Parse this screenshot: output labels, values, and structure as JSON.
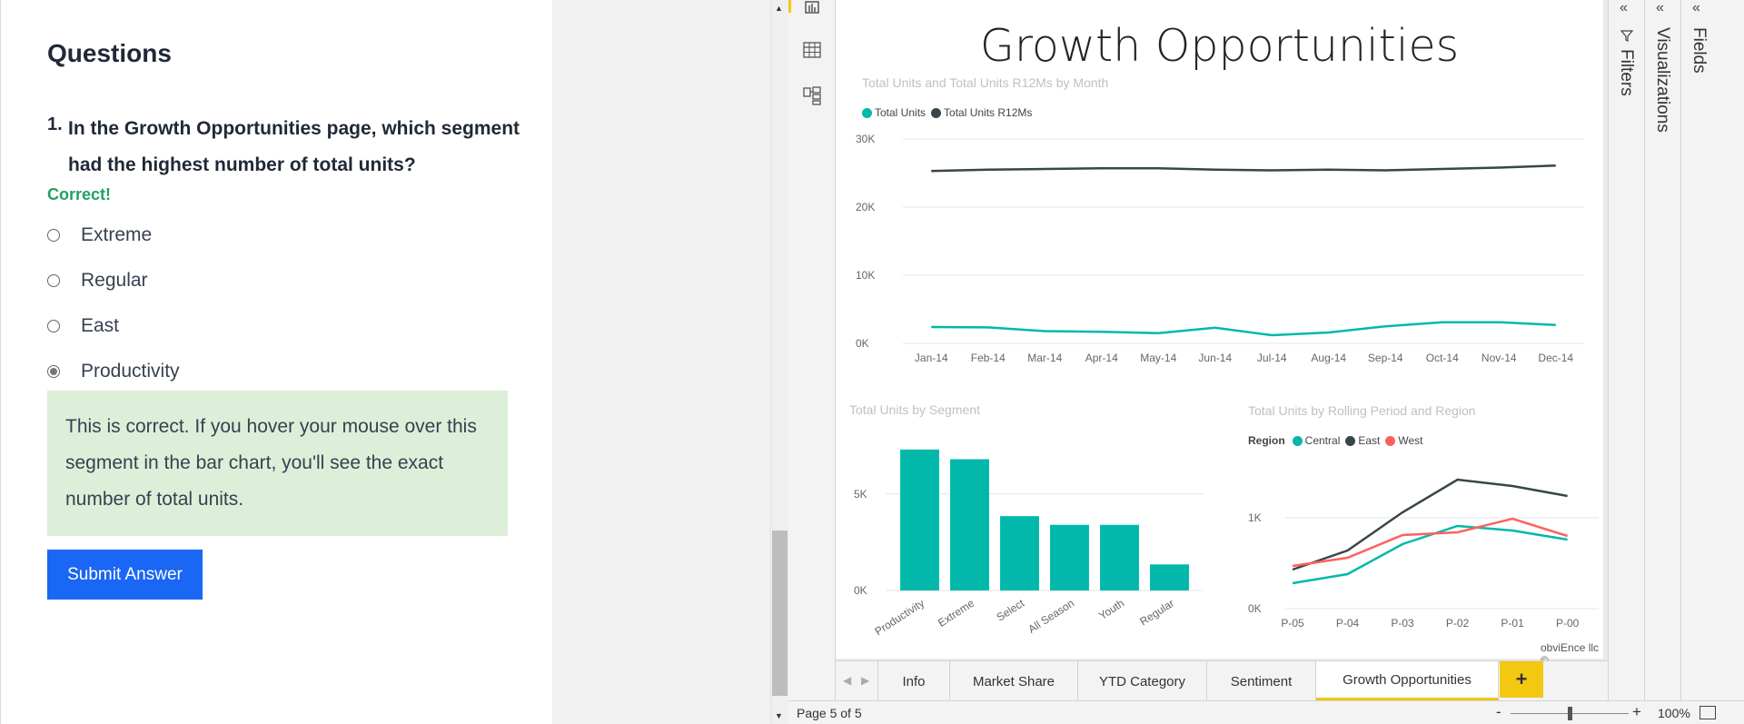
{
  "quiz": {
    "heading": "Questions",
    "question_number": "1.",
    "question_text": "In the Growth Opportunities page, which segment had the highest number of total units?",
    "result": "Correct!",
    "options": [
      "Extreme",
      "Regular",
      "East",
      "Productivity"
    ],
    "selected_option": "Productivity",
    "feedback": "This is correct. If you hover your mouse over this segment in the bar chart, you'll see the exact number of total units.",
    "submit_label": "Submit Answer"
  },
  "report": {
    "page_title": "Growth Opportunities",
    "copyright": "obviEnce llc ©",
    "tabs": [
      "Info",
      "Market Share",
      "YTD Category",
      "Sentiment",
      "Growth Opportunities"
    ],
    "active_tab": "Growth Opportunities",
    "add_tab_label": "+",
    "status": "Page 5 of 5",
    "zoom_minus": "-",
    "zoom_plus": "+",
    "zoom": "100%",
    "zoom_level": 0.5,
    "panes": [
      "Filters",
      "Visualizations",
      "Fields"
    ],
    "pane_chevron": "«",
    "rail_icons": [
      "report-view-icon",
      "data-view-icon",
      "model-view-icon"
    ]
  },
  "colors": {
    "teal": "#01B8AA",
    "dark": "#374649",
    "red": "#FD625E",
    "accent": "#F2C811",
    "submit": "#1A66F5",
    "correct": "#22A060"
  },
  "chart_data": [
    {
      "type": "line",
      "title": "Total Units and Total Units R12Ms by Month",
      "categories": [
        "Jan-14",
        "Feb-14",
        "Mar-14",
        "Apr-14",
        "May-14",
        "Jun-14",
        "Jul-14",
        "Aug-14",
        "Sep-14",
        "Oct-14",
        "Nov-14",
        "Dec-14"
      ],
      "yticks": [
        "30K",
        "20K",
        "10K",
        "0K"
      ],
      "ylim": [
        0,
        30000
      ],
      "series": [
        {
          "name": "Total Units",
          "color": "#01B8AA",
          "values": [
            2400,
            2350,
            1800,
            1700,
            1500,
            2300,
            1200,
            1600,
            2500,
            3100,
            3100,
            2700
          ]
        },
        {
          "name": "Total Units R12Ms",
          "color": "#374649",
          "values": [
            25300,
            25500,
            25600,
            25700,
            25700,
            25500,
            25400,
            25500,
            25400,
            25600,
            25800,
            26100
          ]
        }
      ],
      "legend": "top-left",
      "grid": true
    },
    {
      "type": "bar",
      "title": "Total Units by Segment",
      "categories": [
        "Productivity",
        "Extreme",
        "Select",
        "All Season",
        "Youth",
        "Regular"
      ],
      "values": [
        7300,
        6800,
        3850,
        3400,
        3400,
        1350
      ],
      "yticks": [
        "5K",
        "0K"
      ],
      "ylim": [
        0,
        8000
      ],
      "color": "#01B8AA",
      "grid": true
    },
    {
      "type": "line",
      "title": "Total Units by Rolling Period and Region",
      "legend_title": "Region",
      "categories": [
        "P-05",
        "P-04",
        "P-03",
        "P-02",
        "P-01",
        "P-00"
      ],
      "yticks": [
        "1K",
        "0K"
      ],
      "ylim": [
        0,
        1600
      ],
      "series": [
        {
          "name": "Central",
          "color": "#01B8AA",
          "values": [
            280,
            380,
            710,
            910,
            860,
            760
          ]
        },
        {
          "name": "East",
          "color": "#374649",
          "values": [
            430,
            640,
            1060,
            1420,
            1350,
            1240
          ]
        },
        {
          "name": "West",
          "color": "#FD625E",
          "values": [
            470,
            560,
            810,
            840,
            990,
            800
          ]
        }
      ],
      "legend": "top-left",
      "grid": true
    }
  ]
}
